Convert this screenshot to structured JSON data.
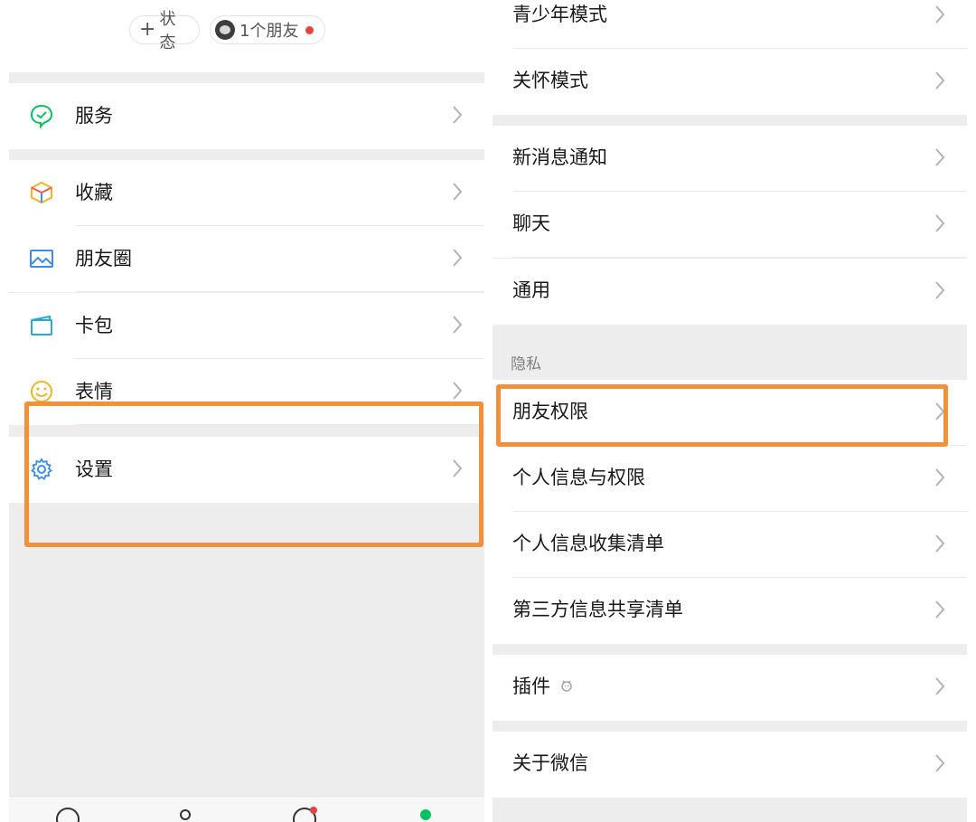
{
  "left_panel": {
    "status_pill": {
      "plus": "+",
      "label": "状态"
    },
    "friends_pill": {
      "label": "1个朋友"
    },
    "rows": [
      {
        "id": "services",
        "label": "服务",
        "icon": "services-icon"
      },
      {
        "id": "favorites",
        "label": "收藏",
        "icon": "favorites-icon"
      },
      {
        "id": "moments",
        "label": "朋友圈",
        "icon": "moments-icon"
      },
      {
        "id": "cards",
        "label": "卡包",
        "icon": "card-wallet-icon"
      },
      {
        "id": "stickers",
        "label": "表情",
        "icon": "sticker-icon"
      },
      {
        "id": "settings",
        "label": "设置",
        "icon": "gear-icon"
      }
    ]
  },
  "right_panel": {
    "rows_top": [
      {
        "id": "teen-mode",
        "label": "青少年模式"
      },
      {
        "id": "care-mode",
        "label": "关怀模式"
      }
    ],
    "rows_group2": [
      {
        "id": "notifications",
        "label": "新消息通知"
      },
      {
        "id": "chats",
        "label": "聊天"
      },
      {
        "id": "general",
        "label": "通用"
      }
    ],
    "privacy_section_label": "隐私",
    "rows_privacy": [
      {
        "id": "friend-permissions",
        "label": "朋友权限"
      },
      {
        "id": "personal-info-permissions",
        "label": "个人信息与权限"
      },
      {
        "id": "personal-info-list",
        "label": "个人信息收集清单"
      },
      {
        "id": "third-party-list",
        "label": "第三方信息共享清单"
      }
    ],
    "plugins": {
      "label": "插件",
      "icon": "plugin-icon"
    },
    "about": {
      "label": "关于微信"
    }
  },
  "colors": {
    "highlight": "#f2913c",
    "background": "#ededed",
    "badge_red": "#e64340",
    "brand_green": "#07c160"
  }
}
